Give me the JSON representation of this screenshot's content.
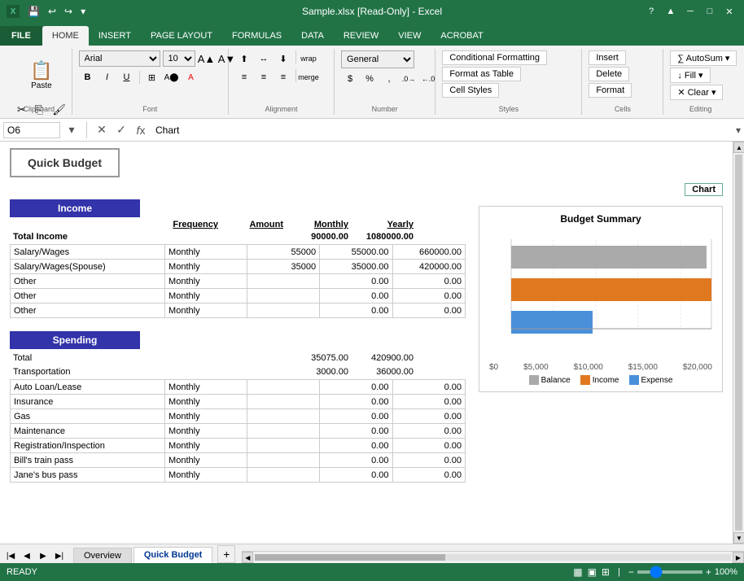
{
  "titlebar": {
    "title": "Sample.xlsx [Read-Only] - Excel",
    "app_icon": "X",
    "quick_access": [
      "save",
      "undo",
      "redo",
      "customize"
    ]
  },
  "ribbon": {
    "tabs": [
      "FILE",
      "HOME",
      "INSERT",
      "PAGE LAYOUT",
      "FORMULAS",
      "DATA",
      "REVIEW",
      "VIEW",
      "ACROBAT"
    ],
    "active_tab": "HOME",
    "groups": {
      "clipboard": "Clipboard",
      "font": "Font",
      "alignment": "Alignment",
      "number": "Number",
      "styles": "Styles",
      "cells": "Cells",
      "editing": "Editing"
    },
    "font": {
      "name": "Arial",
      "size": "10"
    },
    "styles_buttons": {
      "conditional_formatting": "Conditional Formatting",
      "format_as_table": "Format as Table",
      "cell_styles": "Cell Styles"
    },
    "cells_buttons": {
      "insert": "Insert",
      "delete": "Delete",
      "format": "Format"
    },
    "number": {
      "format": "General"
    }
  },
  "formula_bar": {
    "cell_ref": "O6",
    "formula": "Chart"
  },
  "sheet": {
    "title": "Quick Budget",
    "chart_label": "Chart",
    "income_section": {
      "title": "Income",
      "columns": [
        "Frequency",
        "Amount",
        "Monthly",
        "Yearly"
      ],
      "total_row": {
        "label": "Total Income",
        "monthly": "90000.00",
        "yearly": "1080000.00"
      },
      "rows": [
        {
          "label": "Salary/Wages",
          "frequency": "Monthly",
          "amount": "55000",
          "monthly": "55000.00",
          "yearly": "660000.00"
        },
        {
          "label": "Salary/Wages(Spouse)",
          "frequency": "Monthly",
          "amount": "35000",
          "monthly": "35000.00",
          "yearly": "420000.00"
        },
        {
          "label": "Other",
          "frequency": "Monthly",
          "amount": "",
          "monthly": "0.00",
          "yearly": "0.00"
        },
        {
          "label": "Other",
          "frequency": "Monthly",
          "amount": "",
          "monthly": "0.00",
          "yearly": "0.00"
        },
        {
          "label": "Other",
          "frequency": "Monthly",
          "amount": "",
          "monthly": "0.00",
          "yearly": "0.00"
        }
      ]
    },
    "spending_section": {
      "title": "Spending",
      "total_row": {
        "label": "Total",
        "monthly": "35075.00",
        "yearly": "420900.00"
      },
      "categories": [
        {
          "name": "Transportation",
          "monthly": "3000.00",
          "yearly": "36000.00",
          "rows": [
            {
              "label": "Auto Loan/Lease",
              "frequency": "Monthly",
              "amount": "",
              "monthly": "0.00",
              "yearly": "0.00"
            },
            {
              "label": "Insurance",
              "frequency": "Monthly",
              "amount": "",
              "monthly": "0.00",
              "yearly": "0.00"
            },
            {
              "label": "Gas",
              "frequency": "Monthly",
              "amount": "",
              "monthly": "0.00",
              "yearly": "0.00"
            },
            {
              "label": "Maintenance",
              "frequency": "Monthly",
              "amount": "",
              "monthly": "0.00",
              "yearly": "0.00"
            },
            {
              "label": "Registration/Inspection",
              "frequency": "Monthly",
              "amount": "",
              "monthly": "0.00",
              "yearly": "0.00"
            },
            {
              "label": "Bill's train pass",
              "frequency": "Monthly",
              "amount": "",
              "monthly": "0.00",
              "yearly": "0.00"
            },
            {
              "label": "Jane's bus pass",
              "frequency": "Monthly",
              "amount": "",
              "monthly": "0.00",
              "yearly": "0.00"
            }
          ]
        }
      ]
    },
    "chart": {
      "title": "Budget Summary",
      "x_axis": [
        "$0",
        "$5,000",
        "$10,000",
        "$15,000",
        "$20,000"
      ],
      "bars": [
        {
          "label": "Balance",
          "color": "#aaaaaa",
          "width_pct": 95
        },
        {
          "label": "Income",
          "color": "#e07820",
          "width_pct": 100
        },
        {
          "label": "Expense",
          "color": "#4a90d9",
          "width_pct": 40
        }
      ],
      "legend": [
        {
          "label": "Balance",
          "color": "#aaaaaa"
        },
        {
          "label": "Income",
          "color": "#e07820"
        },
        {
          "label": "Expense",
          "color": "#4a90d9"
        }
      ]
    }
  },
  "tabs": {
    "sheets": [
      "Overview",
      "Quick Budget"
    ],
    "active": "Quick Budget"
  },
  "statusbar": {
    "status": "READY",
    "zoom": "100%"
  },
  "window_controls": {
    "minimize": "─",
    "maximize": "□",
    "close": "✕"
  }
}
